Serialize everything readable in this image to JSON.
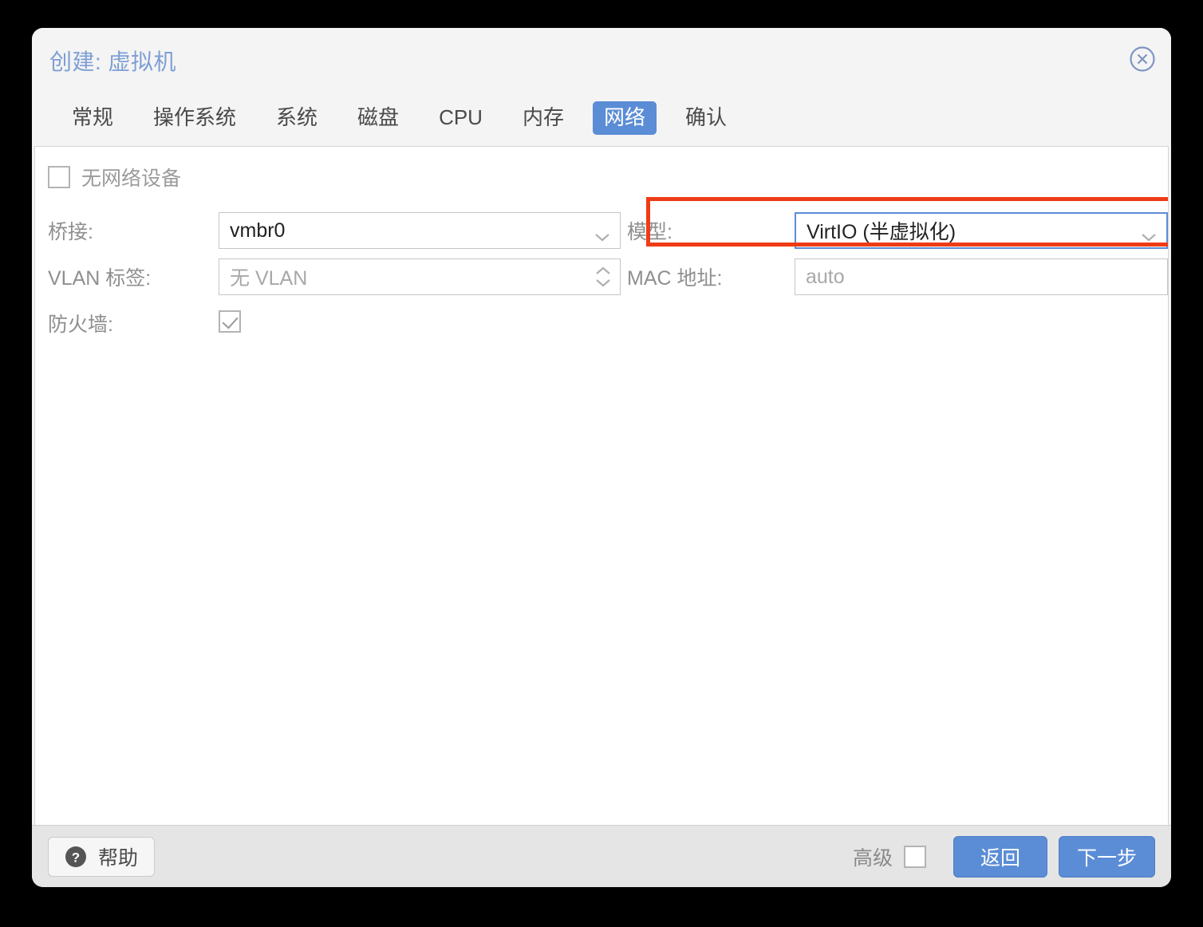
{
  "window": {
    "title": "创建: 虚拟机",
    "close_icon": "close-circle-icon"
  },
  "tabs": [
    {
      "label": "常规",
      "active": false
    },
    {
      "label": "操作系统",
      "active": false
    },
    {
      "label": "系统",
      "active": false
    },
    {
      "label": "磁盘",
      "active": false
    },
    {
      "label": "CPU",
      "active": false
    },
    {
      "label": "内存",
      "active": false
    },
    {
      "label": "网络",
      "active": true
    },
    {
      "label": "确认",
      "active": false
    }
  ],
  "form": {
    "no_network_device": {
      "label": "无网络设备",
      "checked": false
    },
    "left": {
      "bridge": {
        "label": "桥接:",
        "value": "vmbr0",
        "icon": "chevron-down-icon"
      },
      "vlan_tag": {
        "label": "VLAN 标签:",
        "value": "",
        "placeholder": "无 VLAN",
        "icon": "spinner-updown-icon"
      },
      "firewall": {
        "label": "防火墙:",
        "checked": true
      }
    },
    "right": {
      "model": {
        "label": "模型:",
        "value": "VirtIO (半虚拟化)",
        "icon": "chevron-down-icon",
        "focused": true,
        "highlighted": true
      },
      "mac_address": {
        "label": "MAC 地址:",
        "value": "",
        "placeholder": "auto"
      }
    }
  },
  "footer": {
    "help_label": "帮助",
    "help_icon": "question-circle-icon",
    "advanced_label": "高级",
    "advanced_checked": false,
    "back_label": "返回",
    "next_label": "下一步"
  },
  "colors": {
    "accent_blue": "#5b8dd6",
    "title_blue": "#7e9fd4",
    "highlight_red": "#ef3b16",
    "window_bg": "#f4f4f4",
    "footer_bg": "#e5e5e5",
    "content_bg": "#ffffff"
  }
}
